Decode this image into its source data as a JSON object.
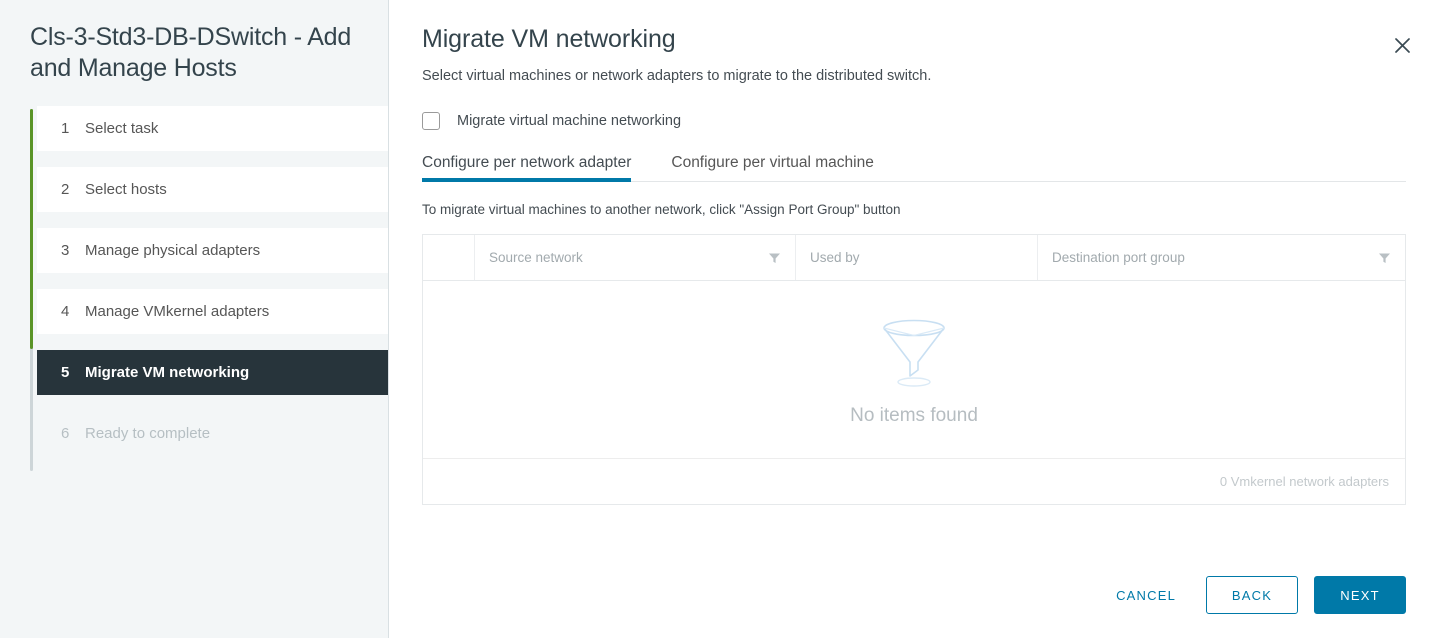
{
  "sidebar": {
    "title": "Cls-3-Std3-DB-DSwitch - Add and Manage Hosts",
    "progress": {
      "completed_steps": 4,
      "total_steps": 6,
      "accent_color": "#5a9427",
      "track_color": "#cdd5d8"
    },
    "steps": [
      {
        "num": "1",
        "label": "Select task",
        "state": "complete"
      },
      {
        "num": "2",
        "label": "Select hosts",
        "state": "complete"
      },
      {
        "num": "3",
        "label": "Manage physical adapters",
        "state": "complete"
      },
      {
        "num": "4",
        "label": "Manage VMkernel adapters",
        "state": "complete"
      },
      {
        "num": "5",
        "label": "Migrate VM networking",
        "state": "active"
      },
      {
        "num": "6",
        "label": "Ready to complete",
        "state": "pending"
      }
    ]
  },
  "header": {
    "title": "Migrate VM networking",
    "subtitle": "Select virtual machines or network adapters to migrate to the distributed switch.",
    "close_icon": "close-icon"
  },
  "content": {
    "checkbox": {
      "label": "Migrate virtual machine networking",
      "checked": false
    },
    "tabs": [
      {
        "label": "Configure per network adapter",
        "active": true
      },
      {
        "label": "Configure per virtual machine",
        "active": false
      }
    ],
    "hint": "To migrate virtual machines to another network, click \"Assign Port Group\" button",
    "table": {
      "columns": [
        {
          "label": "",
          "filter": false
        },
        {
          "label": "Source network",
          "filter": true
        },
        {
          "label": "Used by",
          "filter": false
        },
        {
          "label": "Destination port group",
          "filter": true
        }
      ],
      "rows": [],
      "empty_text": "No items found",
      "empty_icon": "funnel-icon",
      "footer_text": "0 Vmkernel network adapters"
    }
  },
  "footer": {
    "cancel_label": "CANCEL",
    "back_label": "BACK",
    "next_label": "NEXT",
    "accent_color": "#0079a8"
  }
}
